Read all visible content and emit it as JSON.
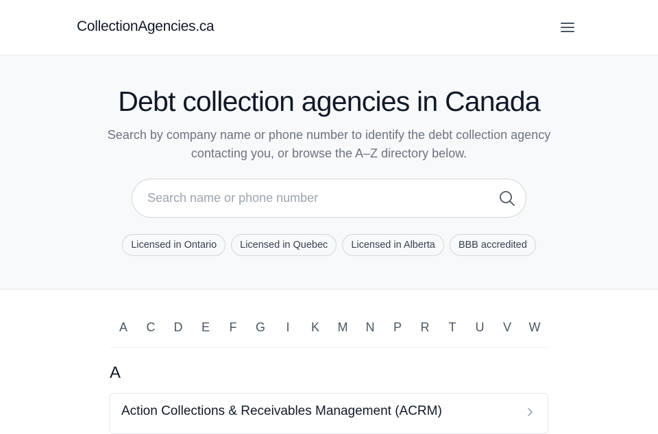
{
  "header": {
    "brand": "CollectionAgencies.ca",
    "menu_icon": "hamburger-menu-icon"
  },
  "hero": {
    "title": "Debt collection agencies in Canada",
    "subtitle": "Search by company name or phone number to identify the debt collection agency contacting you, or browse the A–Z directory below.",
    "search": {
      "placeholder": "Search name or phone number",
      "value": "",
      "icon": "search-icon"
    },
    "filters": [
      {
        "label": "Licensed in Ontario"
      },
      {
        "label": "Licensed in Quebec"
      },
      {
        "label": "Licensed in Alberta"
      },
      {
        "label": "BBB accredited"
      }
    ]
  },
  "directory": {
    "letters": [
      "A",
      "C",
      "D",
      "E",
      "F",
      "G",
      "I",
      "K",
      "M",
      "N",
      "P",
      "R",
      "T",
      "U",
      "V",
      "W"
    ],
    "sections": [
      {
        "letter": "A",
        "agencies": [
          {
            "name": "Action Collections & Receivables Management (ACRM)",
            "icon": "chevron-right-icon"
          }
        ]
      }
    ]
  }
}
